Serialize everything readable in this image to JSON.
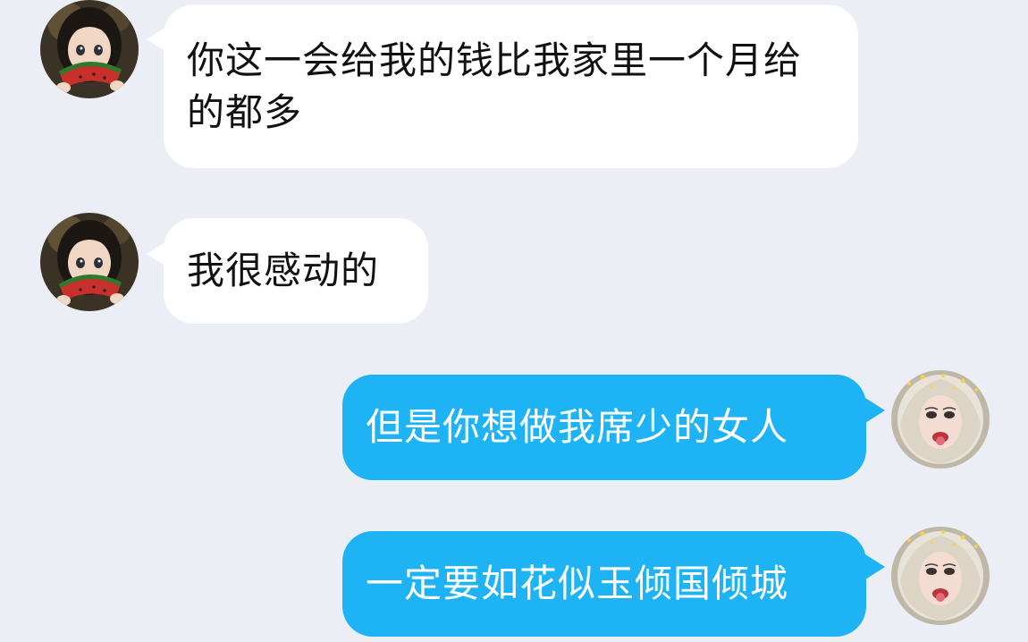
{
  "messages": [
    {
      "side": "received",
      "text": "你这一会给我的钱比我家里一个月给的都多"
    },
    {
      "side": "received",
      "text": "我很感动的"
    },
    {
      "side": "sent",
      "text": "但是你想做我席少的女人"
    },
    {
      "side": "sent",
      "text": "一定要如花似玉倾国倾城"
    }
  ],
  "avatars": {
    "received": "anime-girl-watermelon-avatar",
    "sent": "blonde-woman-avatar"
  },
  "colors": {
    "background": "#eceef6",
    "received_bubble": "#ffffff",
    "sent_bubble": "#1eb3f5"
  }
}
